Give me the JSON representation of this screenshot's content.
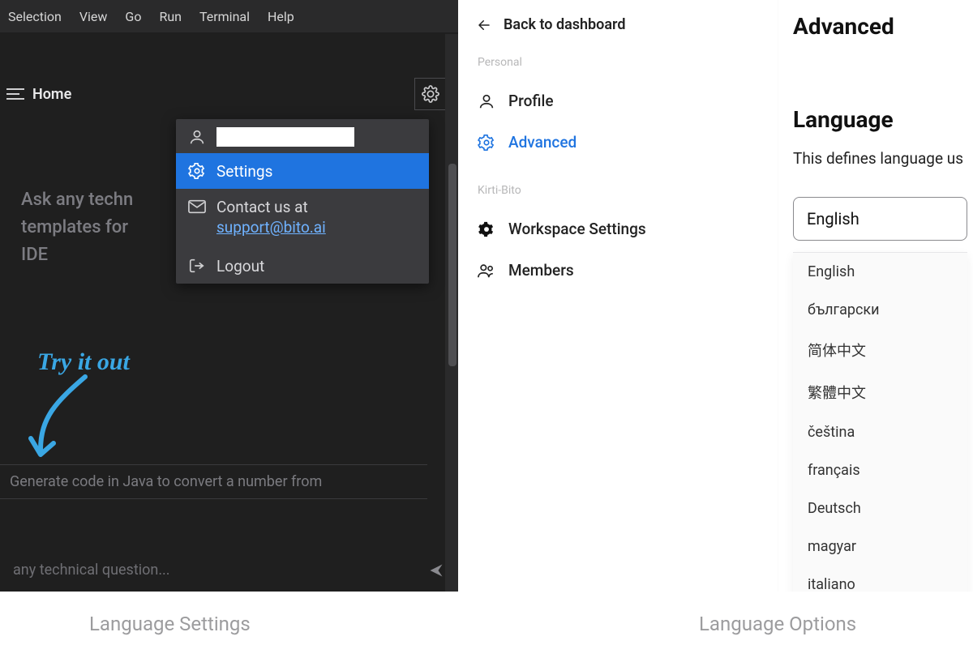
{
  "ide": {
    "menubar": [
      "Selection",
      "View",
      "Go",
      "Run",
      "Terminal",
      "Help"
    ],
    "home_label": "Home",
    "hero": [
      "Ask any techn",
      "templates for",
      "IDE"
    ],
    "try_it": "Try it out",
    "suggestion": "Generate code in Java to convert a number from",
    "ask_placeholder": "any technical question...",
    "dropdown": {
      "settings": "Settings",
      "contact_label": "Contact us at",
      "contact_email": "support@bito.ai",
      "logout": "Logout"
    }
  },
  "settings": {
    "back": "Back to dashboard",
    "sections": {
      "personal": "Personal",
      "workspace": "Kirti-Bito"
    },
    "nav": {
      "profile": "Profile",
      "advanced": "Advanced",
      "workspace_settings": "Workspace Settings",
      "members": "Members"
    },
    "title": "Advanced",
    "section_heading": "Language",
    "section_desc": "This defines language us",
    "selected": "English",
    "options": [
      "English",
      "български",
      "简体中文",
      "繁體中文",
      "čeština",
      "français",
      "Deutsch",
      "magyar",
      "italiano"
    ]
  },
  "captions": {
    "left": "Language Settings",
    "right": "Language Options"
  }
}
